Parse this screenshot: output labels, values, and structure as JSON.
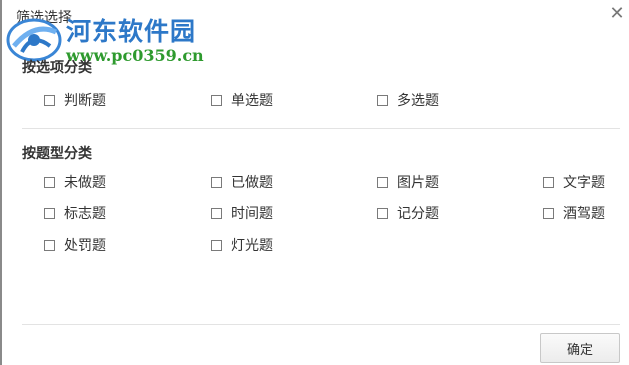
{
  "window": {
    "title": "筛选选择",
    "close_icon": "close-icon"
  },
  "watermark": {
    "site_name": "河东软件园",
    "url": "www.pc0359.cn",
    "colors": {
      "title": "#2d78c8",
      "url": "#2e9a2e"
    }
  },
  "section_options": {
    "title": "按选项分类",
    "items": [
      {
        "label": "判断题",
        "checked": false
      },
      {
        "label": "单选题",
        "checked": false
      },
      {
        "label": "多选题",
        "checked": false
      }
    ]
  },
  "section_types": {
    "title": "按题型分类",
    "items": [
      {
        "label": "未做题",
        "checked": false
      },
      {
        "label": "已做题",
        "checked": false
      },
      {
        "label": "图片题",
        "checked": false
      },
      {
        "label": "文字题",
        "checked": false
      },
      {
        "label": "标志题",
        "checked": false
      },
      {
        "label": "时间题",
        "checked": false
      },
      {
        "label": "记分题",
        "checked": false
      },
      {
        "label": "酒驾题",
        "checked": false
      },
      {
        "label": "处罚题",
        "checked": false
      },
      {
        "label": "灯光题",
        "checked": false
      }
    ]
  },
  "footer": {
    "confirm_label": "确定"
  }
}
